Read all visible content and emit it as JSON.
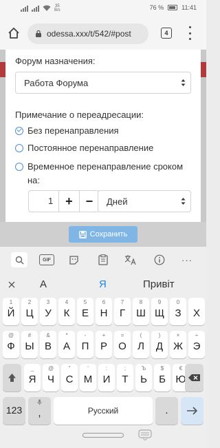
{
  "status_bar": {
    "speed_value": "35",
    "speed_unit": "B/s",
    "battery": "76 %",
    "time": "11:41"
  },
  "browser": {
    "url": "odessa.xxx/t/542/#post",
    "tab_count": "4"
  },
  "form": {
    "forum_label": "Форум назначения:",
    "forum_selected": "Работа Форума",
    "redirect_label": "Примечание о переадресации:",
    "options": [
      "Без перенаправления",
      "Постоянное перенаправление",
      "Временное перенаправление сроком на:"
    ],
    "selected_option_index": 0,
    "duration_value": "1",
    "plus_label": "+",
    "minus_label": "−",
    "unit_selected": "Дней",
    "save_label": "Сохранить"
  },
  "keyboard": {
    "toolbar": [
      "search-icon",
      "gif-icon",
      "sticker-icon",
      "clipboard-icon",
      "translate-icon",
      "info-icon",
      "more-icon"
    ],
    "gif_label": "GIF",
    "more_label": "···",
    "suggestions": [
      "А",
      "Я",
      "Привіт"
    ],
    "row1": [
      {
        "hint": "1",
        "ch": "Й"
      },
      {
        "hint": "2",
        "ch": "Ц"
      },
      {
        "hint": "3",
        "ch": "У"
      },
      {
        "hint": "4",
        "ch": "К"
      },
      {
        "hint": "5",
        "ch": "Е"
      },
      {
        "hint": "6",
        "ch": "Н"
      },
      {
        "hint": "7",
        "ch": "Г"
      },
      {
        "hint": "8",
        "ch": "Ш"
      },
      {
        "hint": "9",
        "ch": "Щ"
      },
      {
        "hint": "0",
        "ch": "З"
      },
      {
        "hint": "",
        "ch": "Х"
      }
    ],
    "row2": [
      {
        "hint": "@",
        "ch": "Ф"
      },
      {
        "hint": "#",
        "ch": "Ы"
      },
      {
        "hint": "&",
        "ch": "В"
      },
      {
        "hint": "*",
        "ch": "А"
      },
      {
        "hint": "-",
        "ch": "П"
      },
      {
        "hint": "+",
        "ch": "Р"
      },
      {
        "hint": "=",
        "ch": "О"
      },
      {
        "hint": "(",
        "ch": "Л"
      },
      {
        "hint": ")",
        "ch": "Д"
      },
      {
        "hint": "×",
        "ch": "Ж"
      },
      {
        "hint": "÷",
        "ch": "Э"
      }
    ],
    "row3": [
      {
        "hint": "_",
        "ch": "Я"
      },
      {
        "hint": "@",
        "ch": "Ч"
      },
      {
        "hint": "\"",
        "ch": "С"
      },
      {
        "hint": "'",
        "ch": "М"
      },
      {
        "hint": ":",
        "ch": "И"
      },
      {
        "hint": ";",
        "ch": "Т"
      },
      {
        "hint": "Ъ",
        "ch": "Ь"
      },
      {
        "hint": "$",
        "ch": "Б"
      },
      {
        "hint": "€",
        "ch": "Ю"
      }
    ],
    "numbers_key": "123",
    "comma_key": ",",
    "space_label": "Русский",
    "period_key": "."
  }
}
